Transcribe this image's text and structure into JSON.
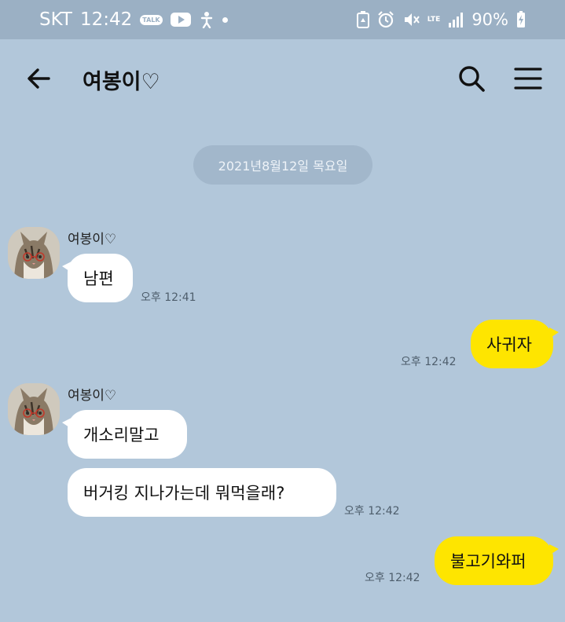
{
  "status_bar": {
    "carrier": "SKT",
    "time": "12:42",
    "talk_badge": "TALK",
    "network": "LTE",
    "battery": "90%"
  },
  "header": {
    "title": "여봉이♡"
  },
  "date_chip": "2021년8월12일 목요일",
  "messages": [
    {
      "sender": "여봉이♡",
      "text": "남편",
      "time": "오후 12:41"
    },
    {
      "text": "사귀자",
      "time": "오후 12:42"
    },
    {
      "sender": "여봉이♡",
      "text": "개소리말고",
      "time": ""
    },
    {
      "text": "버거킹 지나가는데 뭐먹을래?",
      "time": "오후 12:42"
    },
    {
      "text": "불고기와퍼",
      "time": "오후 12:42"
    }
  ]
}
